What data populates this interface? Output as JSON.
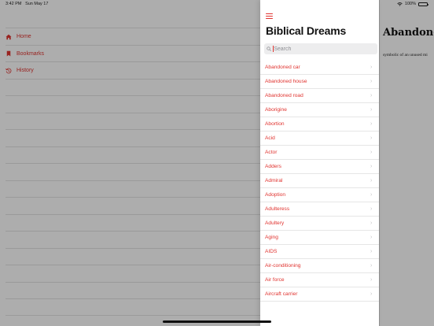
{
  "status_bar": {
    "time": "3:42 PM",
    "date": "Sun May 17",
    "battery": "100%"
  },
  "primary": {
    "nav_items": [
      {
        "label": "Home",
        "icon": "home-icon"
      },
      {
        "label": "Bookmarks",
        "icon": "bookmark-icon"
      },
      {
        "label": "History",
        "icon": "history-icon"
      }
    ]
  },
  "sidebar": {
    "title": "Biblical Dreams",
    "search_placeholder": "Search",
    "items": [
      "Abandoned car",
      "Abandoned house",
      "Abandoned road",
      "Aborigine",
      "Abortion",
      "Acid",
      "Actor",
      "Adders",
      "Admiral",
      "Adoption",
      "Adulteress",
      "Adultery",
      "Aging",
      "AIDS",
      "Air-conditioning",
      "Air force",
      "Aircraft carrier"
    ]
  },
  "detail": {
    "title": "Abandoned",
    "body": "symbolic of an unused mi"
  },
  "colors": {
    "accent": "#e0332f",
    "separator": "#e6e6e6"
  }
}
